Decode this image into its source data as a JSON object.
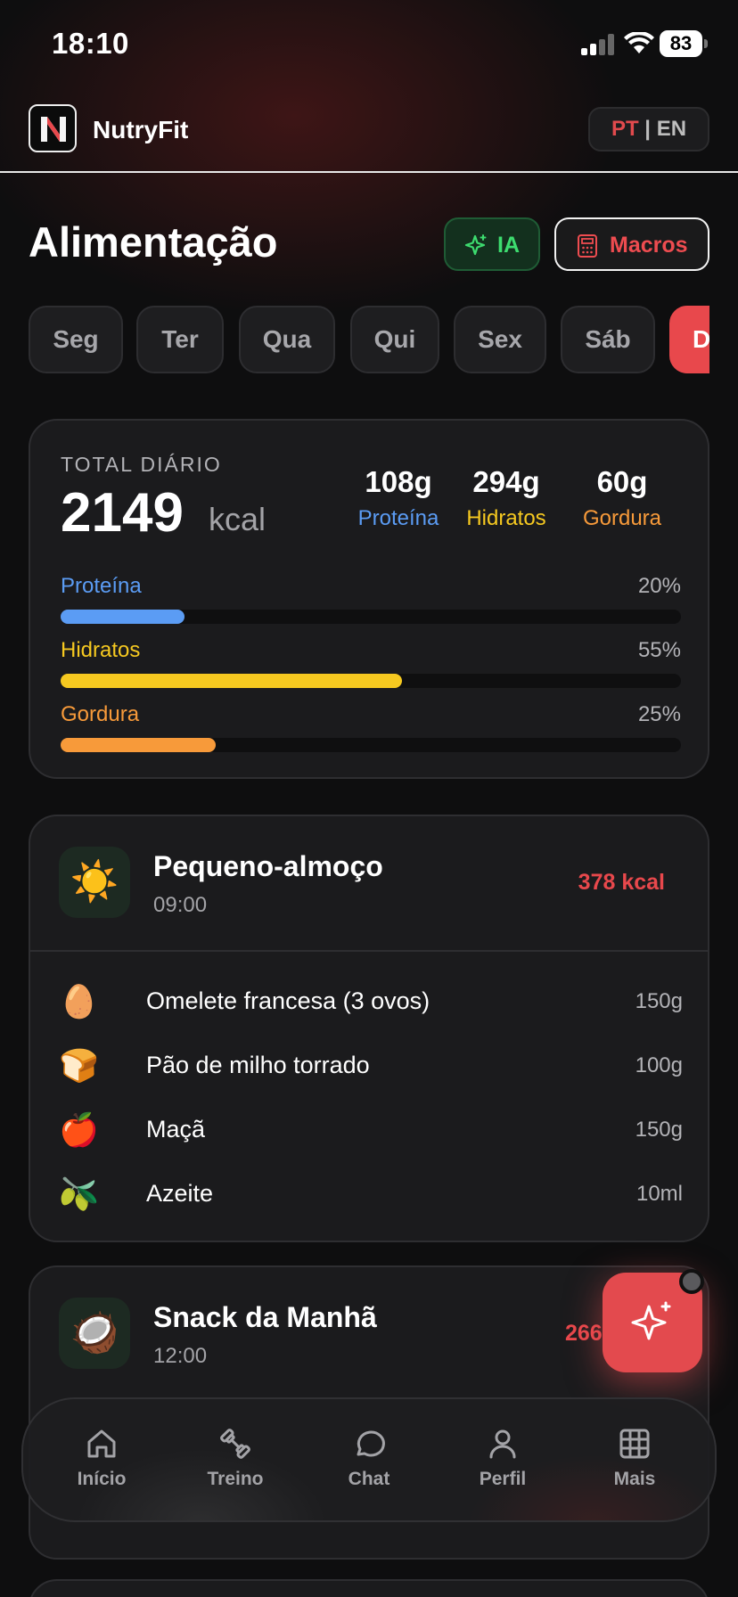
{
  "status": {
    "time": "18:10",
    "battery": "83"
  },
  "header": {
    "app_name": "NutryFit",
    "lang_pt": "PT",
    "lang_sep": "|",
    "lang_en": "EN"
  },
  "page": {
    "title": "Alimentação",
    "ia_label": "IA",
    "macros_label": "Macros"
  },
  "days": [
    "Seg",
    "Ter",
    "Qua",
    "Qui",
    "Sex",
    "Sáb",
    "D"
  ],
  "totals": {
    "label": "TOTAL DIÁRIO",
    "kcal": "2149",
    "unit": "kcal",
    "protein_g": "108g",
    "protein_name": "Proteína",
    "carbs_g": "294g",
    "carbs_name": "Hidratos",
    "fat_g": "60g",
    "fat_name": "Gordura",
    "bars": [
      {
        "label": "Proteína",
        "pct": "20%",
        "fraction": 0.2,
        "color": "#5b9cf4"
      },
      {
        "label": "Hidratos",
        "pct": "55%",
        "fraction": 0.55,
        "color": "#f6c920"
      },
      {
        "label": "Gordura",
        "pct": "25%",
        "fraction": 0.25,
        "color": "#f79a3a"
      }
    ]
  },
  "meals": [
    {
      "name": "Pequeno-almoço",
      "time": "09:00",
      "kcal": "378 kcal",
      "icon": "sun-icon",
      "emoji": "☀️",
      "foods": [
        {
          "name": "Omelete francesa (3 ovos)",
          "qty": "150g",
          "icon": "egg-icon",
          "emoji": "🥚"
        },
        {
          "name": "Pão de milho torrado",
          "qty": "100g",
          "icon": "bread-icon",
          "emoji": "🍞"
        },
        {
          "name": "Maçã",
          "qty": "150g",
          "icon": "apple-icon",
          "emoji": "🍎"
        },
        {
          "name": "Azeite",
          "qty": "10ml",
          "icon": "olive-icon",
          "emoji": "🫒"
        }
      ]
    },
    {
      "name": "Snack da Manhã",
      "time": "12:00",
      "kcal": "266",
      "icon": "coconut-icon",
      "emoji": "🥥"
    }
  ],
  "nav": [
    {
      "label": "Início",
      "icon": "home-icon"
    },
    {
      "label": "Treino",
      "icon": "dumbbell-icon"
    },
    {
      "label": "Chat",
      "icon": "chat-icon"
    },
    {
      "label": "Perfil",
      "icon": "user-icon"
    },
    {
      "label": "Mais",
      "icon": "grid-icon"
    }
  ],
  "colors": {
    "accent": "#e8484c",
    "protein": "#5b9cf4",
    "carbs": "#f6c920",
    "fat": "#f79a3a",
    "ia_green": "#3ddc6f"
  }
}
